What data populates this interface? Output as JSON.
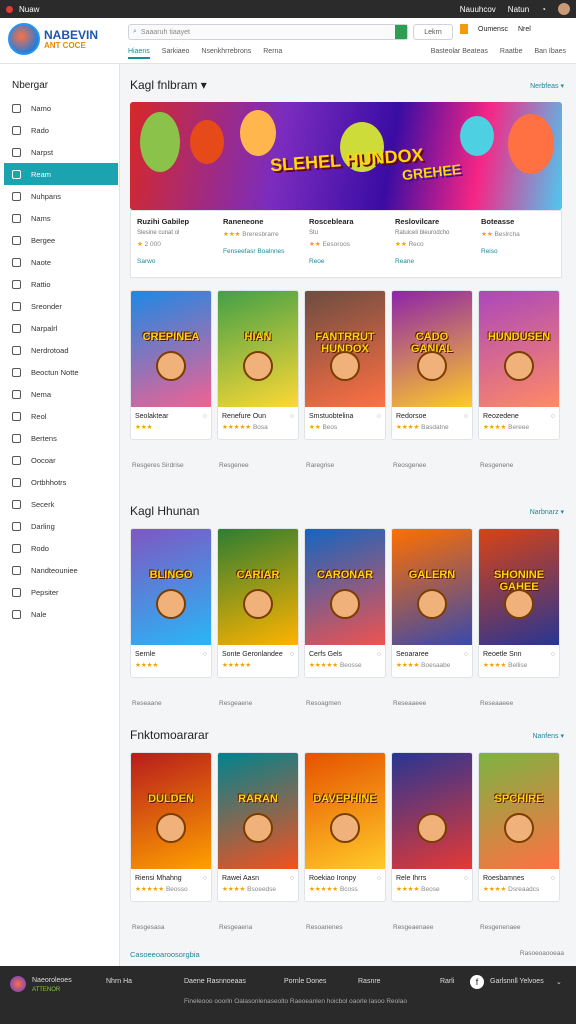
{
  "topbar": {
    "title": "Nuaw",
    "right1": "Nauuhcov",
    "right2": "Natun"
  },
  "logo": {
    "line1": "NABEVIN",
    "line2": "ANT COCE"
  },
  "search": {
    "placeholder": "Saaaruh tiaayet"
  },
  "header_button": "Lekrn",
  "header_right": [
    "Oumensc",
    "Nrel"
  ],
  "nav": [
    "Hiaens",
    "Sarkiaeo",
    "Nsenkhrrebrons",
    "Rerna"
  ],
  "nav_right": [
    "Basteolar Beateas",
    "Raatbe",
    "Ban Ibaes"
  ],
  "sidebar": {
    "title": "Nbergar",
    "items": [
      "Namo",
      "Rado",
      "Narpst",
      "Ream",
      "Nuhpans",
      "Nams",
      "Bergee",
      "Naote",
      "Rattio",
      "Sreonder",
      "Narpalrl",
      "Nerdrotoad",
      "Beoctun Notte",
      "Nema",
      "Reol",
      "Bertens",
      "Oocoar",
      "Ortbhhotrs",
      "Secerk",
      "Darling",
      "Rodo",
      "Nandteouniee",
      "Pepsiter",
      "Nale"
    ],
    "active_index": 3
  },
  "sections": [
    {
      "title": "Kagl fnlbram",
      "link": "Nerbfeas"
    },
    {
      "title": "Kagl Hhunan",
      "link": "Narbnarz"
    },
    {
      "title": "Fnktomoararar",
      "link": "Nanfens"
    }
  ],
  "banner": {
    "title": "SLEHEL HUNDOX",
    "title2": "GREHEE"
  },
  "featured": [
    {
      "name": "Ruzihi Gabilep",
      "sub": "Slesine cunat ol",
      "stars": "★",
      "rating": "2 000",
      "link": "Sarwo"
    },
    {
      "name": "Raneneone",
      "sub": "",
      "stars": "★★★",
      "rating": "Breresbrarre",
      "link": "Fenseefasr Boalnnes"
    },
    {
      "name": "Roscebleara",
      "sub": "Stu",
      "stars": "★★",
      "rating": "Eesoroos",
      "link": "Reoe"
    },
    {
      "name": "Reslovilcare",
      "sub": "Ratuiceli bleurodcho",
      "stars": "★★",
      "rating": "Reco",
      "link": "Reane"
    },
    {
      "name": "Boteasse",
      "sub": "",
      "stars": "★★",
      "rating": "Beslrcha",
      "link": "Reiso"
    }
  ],
  "row1": [
    {
      "label": "CREPINEA",
      "name": "Seolaktear",
      "stars": "★★★",
      "rating": "",
      "meta": "Resgeres Sirdrise"
    },
    {
      "label": "HIAN",
      "name": "Renefure Oun",
      "stars": "★★★★★",
      "rating": "Bosa",
      "meta": "Resgenee"
    },
    {
      "label": "FANTRRUT HUNDOX",
      "name": "Smstuobtelina",
      "stars": "★★",
      "rating": "Beos",
      "meta": "Raregrise"
    },
    {
      "label": "CADO GANIAL",
      "name": "Redorsoe",
      "stars": "★★★★",
      "rating": "Basdatne",
      "meta": "Reosgenee"
    },
    {
      "label": "HUNDUSEN",
      "name": "Reozedene",
      "stars": "★★★★",
      "rating": "Bereee",
      "meta": "Resgenene"
    }
  ],
  "row2": [
    {
      "label": "BLINGO",
      "name": "Sernle",
      "stars": "★★★★",
      "rating": "",
      "meta": "Reseaane"
    },
    {
      "label": "CARIAR",
      "name": "Sonte Geronlandee",
      "stars": "★★★★★",
      "rating": "",
      "meta": "Resgeaene"
    },
    {
      "label": "CARONAR",
      "name": "Cerfs Gels",
      "stars": "★★★★★",
      "rating": "Beosse",
      "meta": "Resoagmen"
    },
    {
      "label": "GALERN",
      "name": "Seoararee",
      "stars": "★★★★",
      "rating": "Boesaabe",
      "meta": "Reseaaeee"
    },
    {
      "label": "SHONINE GAHEE",
      "name": "Reoetle Snn",
      "stars": "★★★★",
      "rating": "Bellise",
      "meta": "Reseaaeee"
    }
  ],
  "row3": [
    {
      "label": "DULDEN",
      "name": "Riensi Mhahng",
      "stars": "★★★★★",
      "rating": "Beosso",
      "meta": "Resgesasa"
    },
    {
      "label": "RARAN",
      "name": "Rawei Aasn",
      "stars": "★★★★",
      "rating": "Bsoeedse",
      "meta": "Resgeaena"
    },
    {
      "label": "DAVEPHINE",
      "name": "Roekiao Ironpy",
      "stars": "★★★★★",
      "rating": "Bcoss",
      "meta": "Resoanenes"
    },
    {
      "label": "",
      "name": "Rele Ihrrs",
      "stars": "★★★★",
      "rating": "Beose",
      "meta": "Resgeaenaee"
    },
    {
      "label": "SPCHIRE",
      "name": "Roesbamnes",
      "stars": "★★★★",
      "rating": "Dsreaadcs",
      "meta": "Resgenenaee"
    }
  ],
  "bottom_link": "Casoeeoaroosorgbia",
  "bottom_right": "Rasoeoaooeaa",
  "footer": {
    "brand": "Naeoroleoes",
    "brand2": "ATTENOR",
    "links": [
      "Nhrn Ha",
      "Daene Rasnnoeaas",
      "Pornle Dones",
      "Rasnre",
      "Rarli",
      "Garlsnnll Yelvoes"
    ],
    "copy": "Fineleooo ooorln Oalasonlenaseolto Raeoeanlen hoicbol oaorle lasoo Reolao"
  }
}
